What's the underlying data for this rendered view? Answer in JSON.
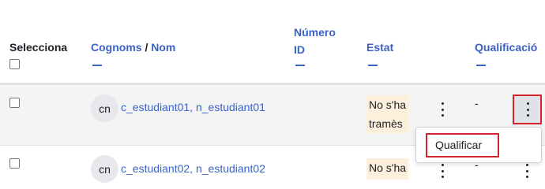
{
  "header": {
    "select_label": "Selecciona",
    "surname_label": "Cognoms",
    "separator": "/",
    "firstname_label": "Nom",
    "id_line1": "Número",
    "id_line2": "ID",
    "status_label": "Estat",
    "grade_label": "Qualificació"
  },
  "rows": [
    {
      "initials": "cn",
      "name": "c_estudiant01, n_estudiant01",
      "status_line1": "No s'ha",
      "status_line2": "tramès",
      "grade": "-"
    },
    {
      "initials": "cn",
      "name": "c_estudiant02, n_estudiant02",
      "status_line1": "No s'ha",
      "grade": "-"
    }
  ],
  "context_menu": {
    "items": [
      "Qualificar"
    ]
  },
  "colors": {
    "link": "#3b62c4",
    "status_bg": "#fcefdc",
    "highlight": "#d4232b"
  }
}
